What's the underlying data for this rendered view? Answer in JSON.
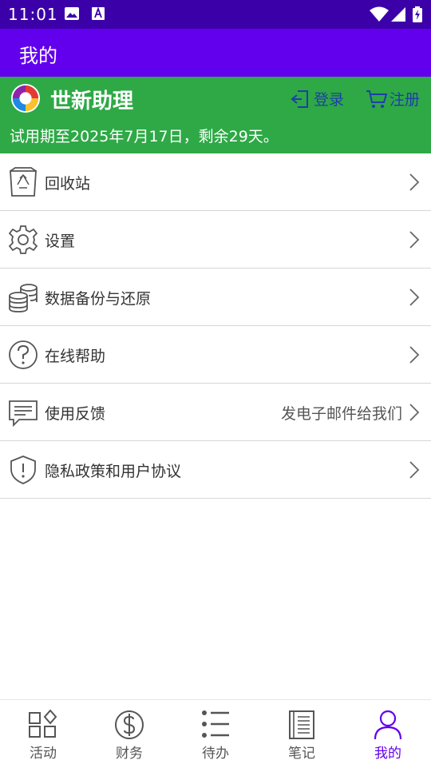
{
  "status_bar": {
    "time": "11:01"
  },
  "app_bar": {
    "title": "我的"
  },
  "header": {
    "app_name": "世新助理",
    "login_label": "登录",
    "register_label": "注册",
    "trial_text": "试用期至2025年7月17日，剩余29天。"
  },
  "menu": {
    "items": [
      {
        "label": "回收站",
        "icon": "recycle-bin-icon"
      },
      {
        "label": "设置",
        "icon": "gear-icon"
      },
      {
        "label": "数据备份与还原",
        "icon": "database-icon"
      },
      {
        "label": "在线帮助",
        "icon": "help-icon"
      },
      {
        "label": "使用反馈",
        "icon": "feedback-icon",
        "right_text": "发电子邮件给我们"
      },
      {
        "label": "隐私政策和用户协议",
        "icon": "shield-icon"
      }
    ]
  },
  "bottom_nav": {
    "items": [
      {
        "label": "活动",
        "icon": "grid-icon"
      },
      {
        "label": "财务",
        "icon": "dollar-icon"
      },
      {
        "label": "待办",
        "icon": "list-icon"
      },
      {
        "label": "笔记",
        "icon": "notebook-icon"
      },
      {
        "label": "我的",
        "icon": "person-icon"
      }
    ],
    "active_index": 4
  },
  "colors": {
    "status_bar": "#3b00a8",
    "app_bar": "#6200ee",
    "header": "#2ea946",
    "header_link": "#1f3ea8",
    "nav_active": "#6200ee"
  }
}
